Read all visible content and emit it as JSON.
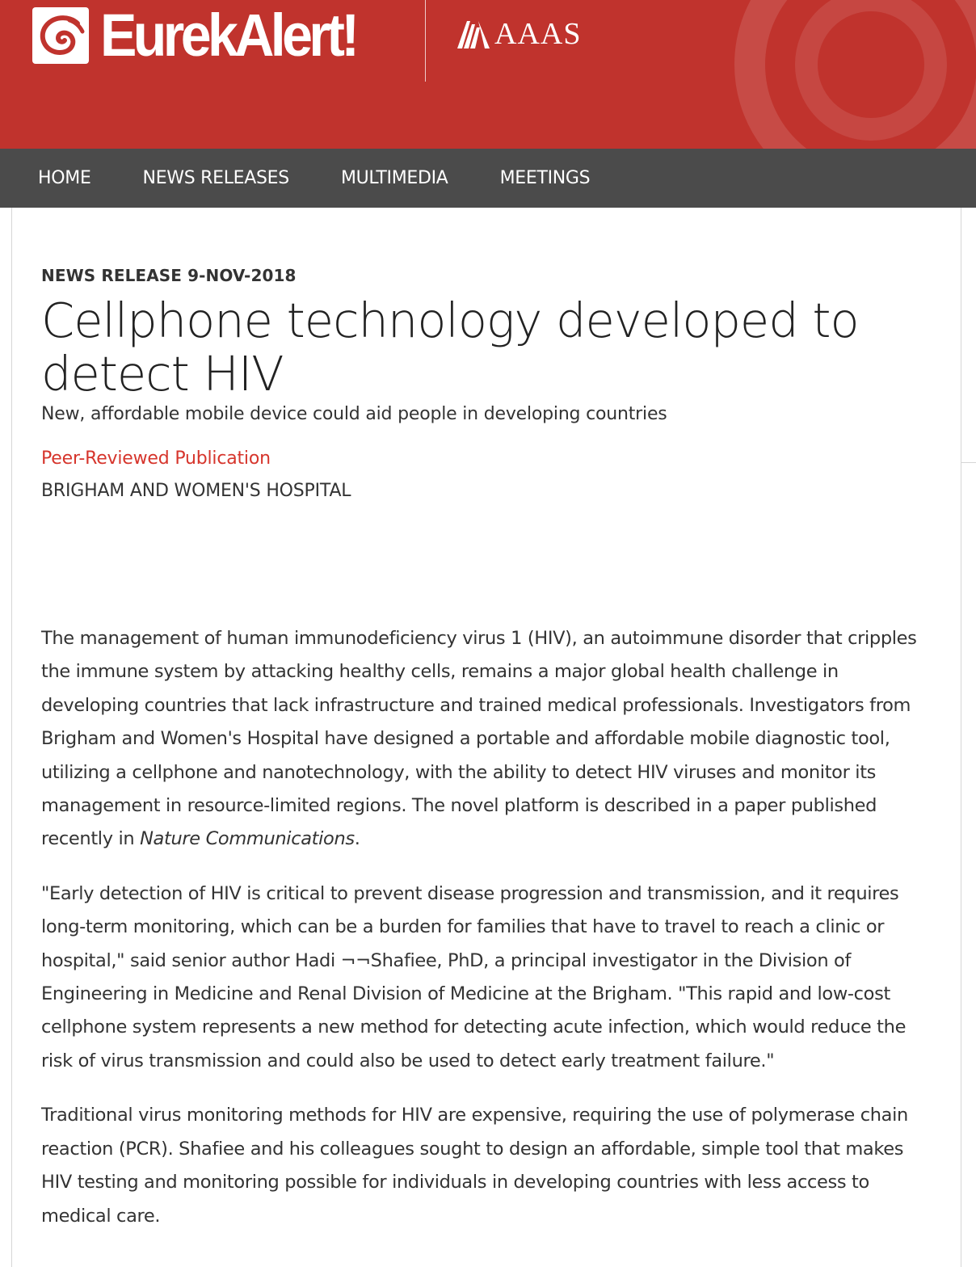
{
  "header": {
    "logo_text": "EurekAlert!",
    "partner_text": "AAAS",
    "colors": {
      "header_bg": "#c0332d",
      "nav_bg": "#4b4b4b",
      "accent": "#d6352c"
    }
  },
  "nav": {
    "items": [
      {
        "label": "HOME"
      },
      {
        "label": "NEWS RELEASES"
      },
      {
        "label": "MULTIMEDIA"
      },
      {
        "label": "MEETINGS"
      }
    ]
  },
  "article": {
    "release_line": "NEWS RELEASE 9-NOV-2018",
    "title": "Cellphone technology developed to detect HIV",
    "subtitle": "New, affordable mobile device could aid people in developing countries",
    "tag": "Peer-Reviewed Publication",
    "institution": "BRIGHAM AND WOMEN'S HOSPITAL",
    "paragraphs": [
      {
        "text_before": "The management of human immunodeficiency virus 1 (HIV), an autoimmune disorder that cripples the immune system by attacking healthy cells, remains a major global health challenge in developing countries that lack infrastructure and trained medical professionals. Investigators from Brigham and Women's Hospital have designed a portable and affordable mobile diagnostic tool, utilizing a cellphone and nanotechnology, with the ability to detect HIV viruses and monitor its management in resource-limited regions. The novel platform is described in a paper published recently in ",
        "italic": "Nature Communications",
        "text_after": "."
      },
      {
        "text": "\"Early detection of HIV is critical to prevent disease progression and transmission, and it requires long-term monitoring, which can be a burden for families that have to travel to reach a clinic or hospital,\" said senior author Hadi ¬¬Shafiee, PhD, a principal investigator in the Division of Engineering in Medicine and Renal Division of Medicine at the Brigham. \"This rapid and low-cost cellphone system represents a new method for detecting acute infection, which would reduce the risk of virus transmission and could also be used to detect early treatment failure.\""
      },
      {
        "text": "Traditional virus monitoring methods for HIV are expensive, requiring the use of polymerase chain reaction (PCR). Shafiee and his colleagues sought to design an affordable, simple tool that makes HIV testing and monitoring possible for individuals in developing countries with less access to medical care."
      }
    ]
  },
  "icons": {
    "logo": "eurekalert-swirl-icon",
    "partner": "aaas-mark-icon"
  }
}
